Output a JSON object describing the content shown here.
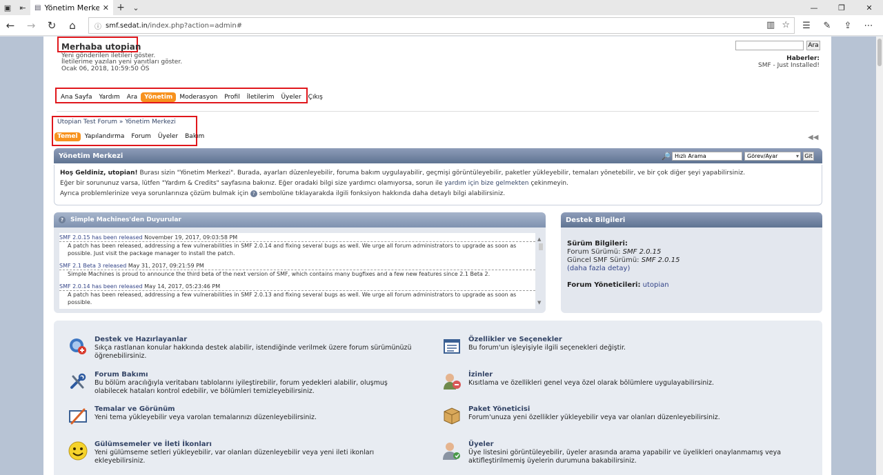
{
  "browser": {
    "tab_title": "Yönetim Merkezi",
    "url_domain": "smf.sedat.in",
    "url_path": "/index.php?action=admin#"
  },
  "header": {
    "greeting": "Merhaba utopian",
    "links": [
      "Yeni gönderilen iletileri göster.",
      "İletilerime yazılan yeni yanıtları göster.",
      "Ocak 06, 2018, 10:59:50 ÖS"
    ],
    "search_button": "Ara",
    "news_title": "Haberler:",
    "news_text": "SMF - Just Installed!"
  },
  "main_menu": [
    "Ana Sayfa",
    "Yardım",
    "Ara",
    "Yönetim",
    "Moderasyon",
    "Profil",
    "İletilerim",
    "Üyeler",
    "Çıkış"
  ],
  "main_menu_active": "Yönetim",
  "breadcrumb": {
    "root": "Utopian Test Forum",
    "sep": "»",
    "current": "Yönetim Merkezi"
  },
  "sub_menu": [
    "Temel",
    "Yapılandırma",
    "Forum",
    "Üyeler",
    "Bakım"
  ],
  "admin_center": {
    "title": "Yönetim Merkezi",
    "quick_search_placeholder": "Hızlı Arama",
    "quick_search_select": "Görev/Ayar",
    "quick_search_button": "Git",
    "welcome_bold": "Hoş Geldiniz, utopian!",
    "welcome_text": " Burası sizin \"Yönetim Merkezi\". Burada, ayarları düzenleyebilir, foruma bakım uygulayabilir, geçmişi görüntüleyebilir, paketler yükleyebilir, temaları yönetebilir, ve bir çok diğer şeyi yapabilirsiniz.",
    "problem_text_a": "Eğer bir sorununuz varsa, lütfen \"Yardım & Credits\" sayfasına bakınız. Eğer oradaki bilgi size yardımcı olamıyorsa, sorun ile ",
    "problem_link": "yardım için bize gelmekten",
    "problem_text_b": " çekinmeyin.",
    "help_text_a": "Ayrıca problemlerinize veya sorunlarınıza çözüm bulmak için ",
    "help_text_b": " sembolüne tıklayarakda ilgili fonksiyon hakkında daha detaylı bilgi alabilirsiniz."
  },
  "announcements": {
    "title": "Simple Machines'den Duyurular",
    "items": [
      {
        "link": "SMF 2.0.15 has been released",
        "date": "November 19, 2017, 09:03:58 PM",
        "body": "A patch has been released, addressing a few vulnerabilities in SMF 2.0.14 and fixing several bugs as well. We urge all forum administrators to upgrade as soon as possible. Just visit the package manager to install the patch."
      },
      {
        "link": "SMF 2.1 Beta 3 released",
        "date": "May 31, 2017, 09:21:59 PM",
        "body": "Simple Machines is proud to announce the third beta of the next version of SMF, which contains many bugfixes and a few new features since 2.1 Beta 2."
      },
      {
        "link": "SMF 2.0.14 has been released",
        "date": "May 14, 2017, 05:23:46 PM",
        "body": "A patch has been released, addressing a few vulnerabilities in SMF 2.0.13 and fixing several bugs as well. We urge all forum administrators to upgrade as soon as possible."
      }
    ]
  },
  "support": {
    "title": "Destek Bilgileri",
    "version_label": "Sürüm Bilgileri:",
    "forum_version_label": "Forum Sürümü:",
    "forum_version": "SMF 2.0.15",
    "current_version_label": "Güncel SMF Sürümü:",
    "current_version": "SMF 2.0.15",
    "more_details": "(daha fazla detay)",
    "admins_label": "Forum Yöneticileri:",
    "admins": "utopian"
  },
  "tools": [
    {
      "icon": "support-credits-icon",
      "title": "Destek ve Hazırlayanlar",
      "desc": "Sıkça rastlanan konular hakkında destek alabilir, istendiğinde verilmek üzere forum sürümünüzü öğrenebilirsiniz."
    },
    {
      "icon": "features-options-icon",
      "title": "Özellikler ve Seçenekler",
      "desc": "Bu forum'un işleyişiyle ilgili seçenekleri değiştir."
    },
    {
      "icon": "forum-maintenance-icon",
      "title": "Forum Bakımı",
      "desc": "Bu bölüm aracılığıyla veritabanı tablolarını iyileştirebilir, forum yedekleri alabilir, oluşmuş olabilecek hataları kontrol edebilir, ve bölümleri temizleyebilirsiniz."
    },
    {
      "icon": "permissions-icon",
      "title": "İzinler",
      "desc": "Kısıtlama ve özellikleri genel veya özel olarak bölümlere uygulayabilirsiniz."
    },
    {
      "icon": "themes-icon",
      "title": "Temalar ve Görünüm",
      "desc": "Yeni tema yükleyebilir veya varolan temalarınızı düzenleyebilirsiniz."
    },
    {
      "icon": "package-manager-icon",
      "title": "Paket Yöneticisi",
      "desc": "Forum'unuza yeni özellikler yükleyebilir veya var olanları düzenleyebilirsiniz."
    },
    {
      "icon": "smileys-icon",
      "title": "Gülümsemeler ve İleti İkonları",
      "desc": "Yeni gülümseme setleri yükleyebilir, var olanları düzenleyebilir veya yeni ileti ikonları ekleyebilirsiniz."
    },
    {
      "icon": "members-icon",
      "title": "Üyeler",
      "desc": "Üye listesini görüntüleyebilir, üyeler arasında arama yapabilir ve üyelikleri onaylanmamış veya aktifleştirilmemiş üyelerin durumuna bakabilirsiniz."
    }
  ],
  "colors": {
    "active_menu": "#f7921e",
    "catbar": "#5f7392",
    "highlight_box": "#e0161b"
  }
}
